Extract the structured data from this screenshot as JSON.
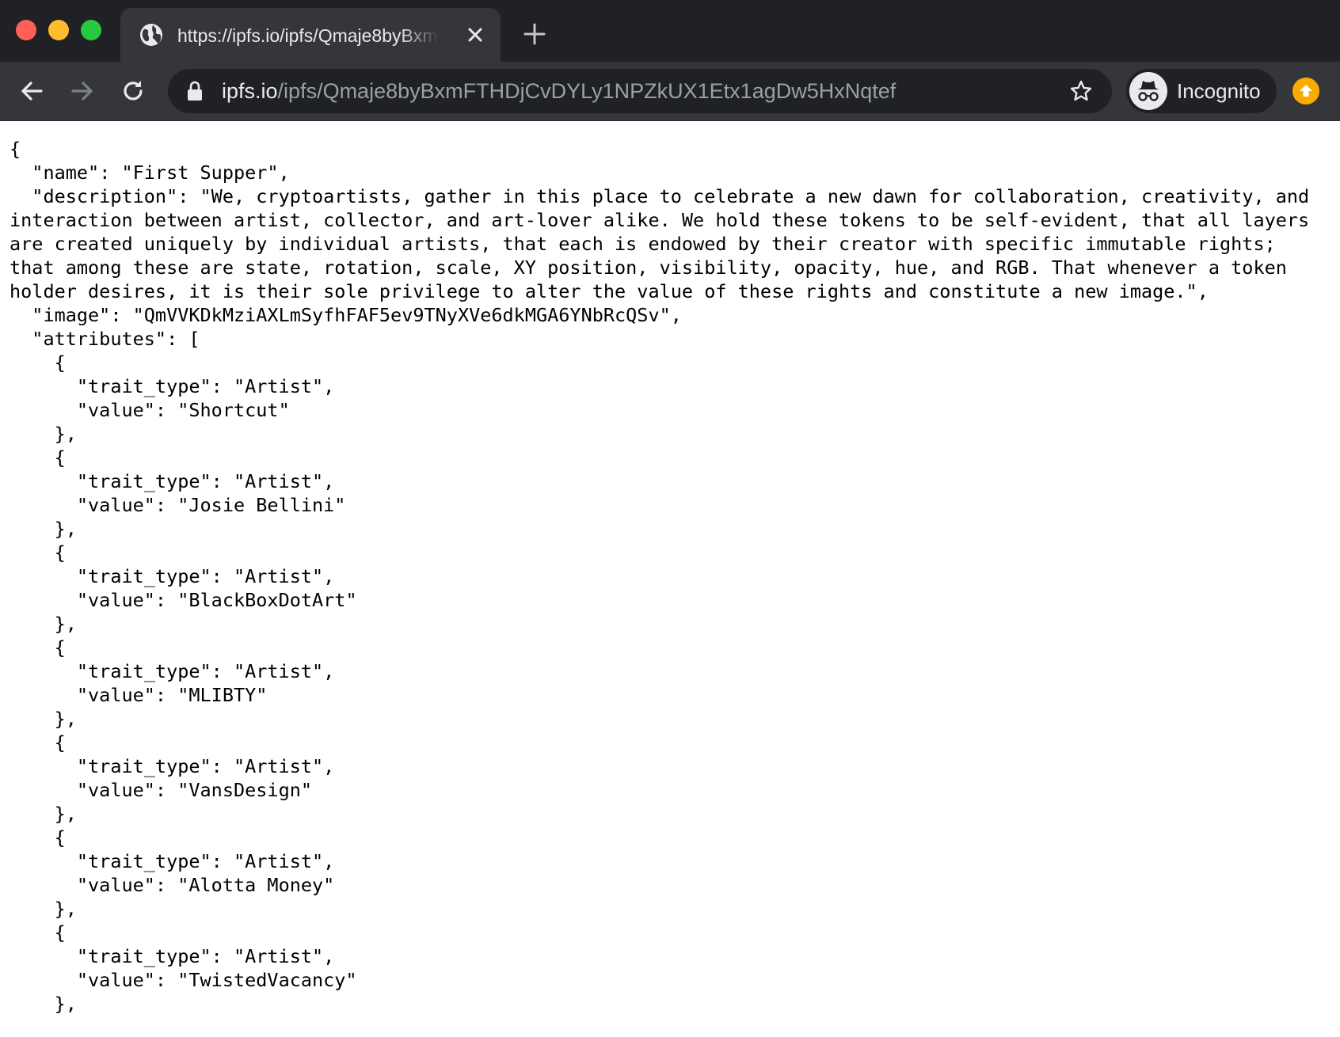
{
  "window": {
    "tab_title": "https://ipfs.io/ipfs/Qmaje8byBxmFTHDjCvDYLy1NPZkUX1Etx1agDw5HxNqtef",
    "colors": {
      "close_red": "#ff5f57",
      "minimize_yellow": "#febc2e",
      "zoom_green": "#28c840",
      "update_badge": "#f9ab00"
    }
  },
  "toolbar": {
    "url_host": "ipfs.io",
    "url_path": "/ipfs/Qmaje8byBxmFTHDjCvDYLy1NPZkUX1Etx1agDw5HxNqtef",
    "profile_label": "Incognito",
    "icons": [
      "back-icon",
      "forward-icon",
      "reload-icon",
      "lock-icon",
      "star-icon",
      "incognito-icon",
      "update-icon"
    ]
  },
  "document": {
    "open_brace": "{",
    "name_key": "\"name\"",
    "name_value": "\"First Supper\"",
    "description_key": "\"description\"",
    "description_value": "\"We, cryptoartists, gather in this place to celebrate a new dawn for collaboration, creativity, and interaction between artist, collector, and art-lover alike. We hold these tokens to be self-evident, that all layers are created uniquely by individual artists, that each is endowed by their creator with specific immutable rights; that among these are state, rotation, scale, XY position, visibility, opacity, hue, and RGB. That whenever a token holder desires, it is their sole privilege to alter the value of these rights and constitute a new image.\"",
    "image_key": "\"image\"",
    "image_value": "\"QmVVKDkMziAXLmSyfhFAF5ev9TNyXVe6dkMGA6YNbRcQSv\"",
    "attributes_key": "\"attributes\"",
    "attributes": [
      {
        "trait_type": "\"Artist\"",
        "value": "\"Shortcut\""
      },
      {
        "trait_type": "\"Artist\"",
        "value": "\"Josie Bellini\""
      },
      {
        "trait_type": "\"Artist\"",
        "value": "\"BlackBoxDotArt\""
      },
      {
        "trait_type": "\"Artist\"",
        "value": "\"MLIBTY\""
      },
      {
        "trait_type": "\"Artist\"",
        "value": "\"VansDesign\""
      },
      {
        "trait_type": "\"Artist\"",
        "value": "\"Alotta Money\""
      },
      {
        "trait_type": "\"Artist\"",
        "value": "\"TwistedVacancy\""
      }
    ]
  }
}
